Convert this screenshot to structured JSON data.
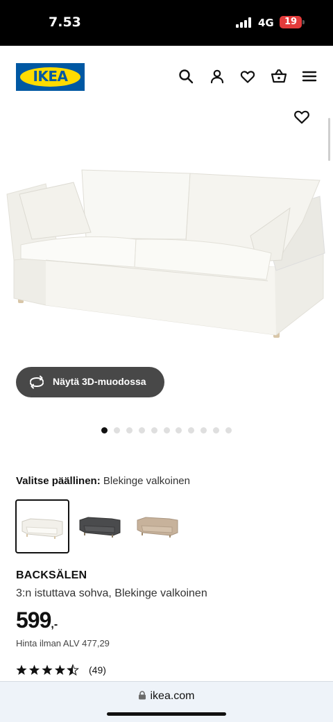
{
  "status_bar": {
    "time": "7.53",
    "network": "4G",
    "battery": "19"
  },
  "header": {
    "logo_text": "IKEA",
    "icons": [
      "search-icon",
      "account-icon",
      "heart-icon",
      "basket-icon",
      "menu-icon"
    ]
  },
  "gallery": {
    "view_3d_label": "Näytä 3D-muodossa",
    "image_count": 11,
    "active_index": 0
  },
  "cover": {
    "label": "Valitse päällinen:",
    "selected": "Blekinge valkoinen",
    "swatch_colors": [
      "#f2f0ea",
      "#4a4b4d",
      "#c7b29b"
    ],
    "selected_index": 0
  },
  "product": {
    "name": "BACKSÄLEN",
    "description": "3:n istuttava sohva, Blekinge valkoinen",
    "price": "599",
    "price_suffix": ",-",
    "vat_text": "Hinta ilman ALV 477,29",
    "rating": 4.5,
    "review_count": "(49)"
  },
  "browser": {
    "url": "ikea.com"
  },
  "colors": {
    "ikea_blue": "#0058a3",
    "ikea_yellow": "#ffdb00",
    "button_dark": "#484848",
    "battery_red": "#e33b3b"
  }
}
